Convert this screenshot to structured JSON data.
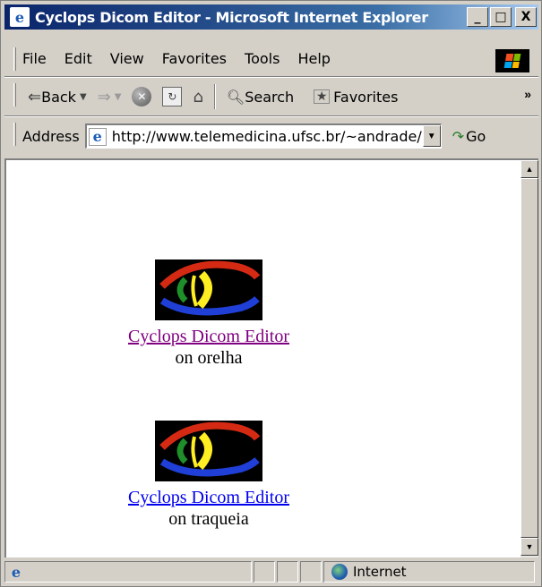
{
  "window": {
    "title": "Cyclops Dicom Editor - Microsoft Internet Explorer",
    "app_icon": "ie-icon"
  },
  "titlebar_buttons": {
    "minimize": "_",
    "maximize": "□",
    "close": "X"
  },
  "menu": [
    "File",
    "Edit",
    "View",
    "Favorites",
    "Tools",
    "Help"
  ],
  "toolbar": {
    "back_label": "Back",
    "forward_label": "⇒",
    "search_label": "Search",
    "favorites_label": "Favorites",
    "more": "»"
  },
  "address": {
    "label": "Address",
    "value": "http://www.telemedicina.ufsc.br/~andrade/",
    "go_label": "Go"
  },
  "content": {
    "items": [
      {
        "link_text": "Cyclops Dicom Editor",
        "subtitle": "on orelha",
        "visited": true
      },
      {
        "link_text": "Cyclops Dicom Editor",
        "subtitle": "on traqueia",
        "visited": false
      }
    ]
  },
  "status": {
    "zone": "Internet"
  },
  "colors": {
    "title_start": "#0a246a",
    "title_end": "#a6caf0",
    "visited_link": "#800080",
    "link": "#0000ee",
    "chrome": "#d4d0c8"
  }
}
